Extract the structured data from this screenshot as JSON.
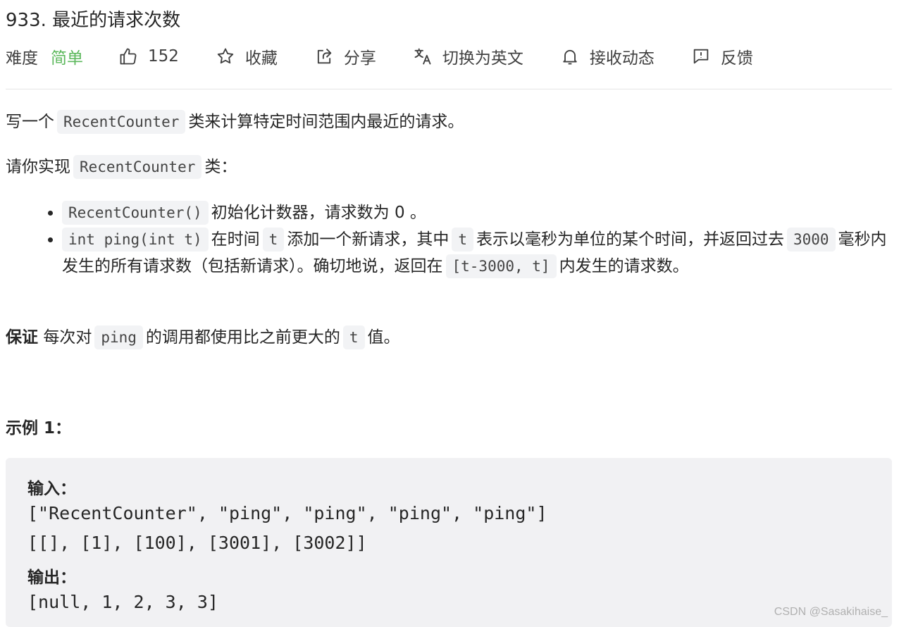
{
  "problem": {
    "title": "933. 最近的请求次数"
  },
  "meta": {
    "difficulty_label": "难度",
    "difficulty_value": "简单",
    "likes": "152",
    "favorite": "收藏",
    "share": "分享",
    "switch_lang": "切换为英文",
    "subscribe": "接收动态",
    "feedback": "反馈",
    "colors": {
      "easy": "#5cb85c"
    }
  },
  "desc": {
    "p1_before": "写一个",
    "p1_code": "RecentCounter",
    "p1_after": "类来计算特定时间范围内最近的请求。",
    "p2_before": "请你实现",
    "p2_code": "RecentCounter",
    "p2_after": "类：",
    "b1_code": "RecentCounter()",
    "b1_text": "初始化计数器，请求数为 0 。",
    "b2_code1": "int ping(int t)",
    "b2_text1": "在时间",
    "b2_code2": "t",
    "b2_text2": "添加一个新请求，其中",
    "b2_code3": "t",
    "b2_text3": "表示以毫秒为单位的某个时间，并返回过去",
    "b2_code4": "3000",
    "b2_text4": "毫秒内发生的所有请求数（包括新请求）。确切地说，返回在",
    "b2_code5": "[t-3000, t]",
    "b2_text5": "内发生的请求数。",
    "p3_bold": "保证",
    "p3_text1": "每次对",
    "p3_code1": "ping",
    "p3_text2": "的调用都使用比之前更大的",
    "p3_code2": "t",
    "p3_text3": "值。"
  },
  "example": {
    "title": "示例 1：",
    "input_label": "输入：",
    "input_line1": "[\"RecentCounter\", \"ping\", \"ping\", \"ping\", \"ping\"]",
    "input_line2": "[[], [1], [100], [3001], [3002]]",
    "output_label": "输出：",
    "output_line": "[null, 1, 2, 3, 3]"
  },
  "watermark": "CSDN @Sasakihaise_"
}
